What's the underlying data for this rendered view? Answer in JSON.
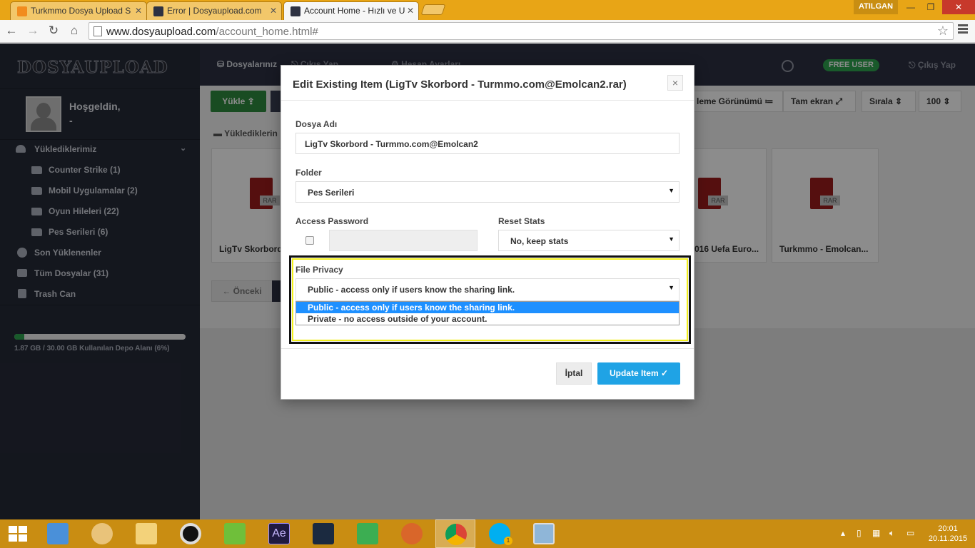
{
  "browser": {
    "tabs": [
      {
        "label": "Turkmmo Dosya Upload S",
        "active": false
      },
      {
        "label": "Error | Dosyaupload.com",
        "active": false
      },
      {
        "label": "Account Home - Hızlı ve U",
        "active": true
      }
    ],
    "user_badge": "ATILGAN",
    "url_host": "www.dosyaupload.com",
    "url_path": "/account_home.html#",
    "window_controls": {
      "minimize": "—",
      "maximize": "❐",
      "close": "✕"
    }
  },
  "site": {
    "logo": "DOSYAUPLOAD",
    "welcome": "Hoşgeldin,",
    "username": "-",
    "top_nav": {
      "files": "Dosyalarınız",
      "logout_tab": "Çıkış Yap",
      "settings": "Hesap Ayarları",
      "free_user": "FREE USER",
      "logout": "Çıkış Yap"
    },
    "sidebar": {
      "uploads_label": "Yüklediklerimiz",
      "folders": [
        {
          "label": "Counter Strike (1)"
        },
        {
          "label": "Mobil Uygulamalar (2)"
        },
        {
          "label": "Oyun Hileleri (22)"
        },
        {
          "label": "Pes Serileri (6)"
        }
      ],
      "recent": "Son Yüklenenler",
      "all_files": "Tüm Dosyalar (31)",
      "trash": "Trash Can",
      "storage_text": "1.87 GB / 30.00 GB Kullanılan Depo Alanı (6%)",
      "storage_percent": 6
    },
    "main": {
      "upload_btn": "Yükle",
      "list_view_btn": "leme Görünümü",
      "fullscreen_btn": "Tam ekran",
      "sort_btn": "Sırala",
      "per_page": "100",
      "breadcrumb": "Yüklediklerin",
      "prev_btn": "Önceki",
      "files": [
        {
          "name": "LigTv Skorbord"
        },
        {
          "name": "016 Uefa Euro..."
        },
        {
          "name": "Turkmmo - Emolcan..."
        }
      ],
      "file_tag": "RAR"
    }
  },
  "modal": {
    "title": "Edit Existing Item (LigTv Skorbord - Turmmo.com@Emolcan2.rar)",
    "close": "×",
    "filename_label": "Dosya Adı",
    "filename_value": "LigTv Skorbord - Turmmo.com@Emolcan2",
    "folder_label": "Folder",
    "folder_value": "Pes Serileri",
    "password_label": "Access Password",
    "reset_label": "Reset Stats",
    "reset_value": "No, keep stats",
    "privacy_label": "File Privacy",
    "privacy_value": "Public - access only if users know the sharing link.",
    "privacy_options": [
      "Public - access only if users know the sharing link.",
      "Private - no access outside of your account."
    ],
    "cancel_btn": "İptal",
    "update_btn": "Update Item"
  },
  "taskbar": {
    "time": "20:01",
    "date": "20.11.2015",
    "ae_label": "Ae",
    "skype_badge": "1"
  },
  "colors": {
    "tab_strip": "#e8a516",
    "sidebar": "#262a38",
    "accent_green": "#2ea44f",
    "update_blue": "#1fa3e5",
    "selected_option": "#1e90ff",
    "highlight_yellow": "#f2ef1a"
  }
}
